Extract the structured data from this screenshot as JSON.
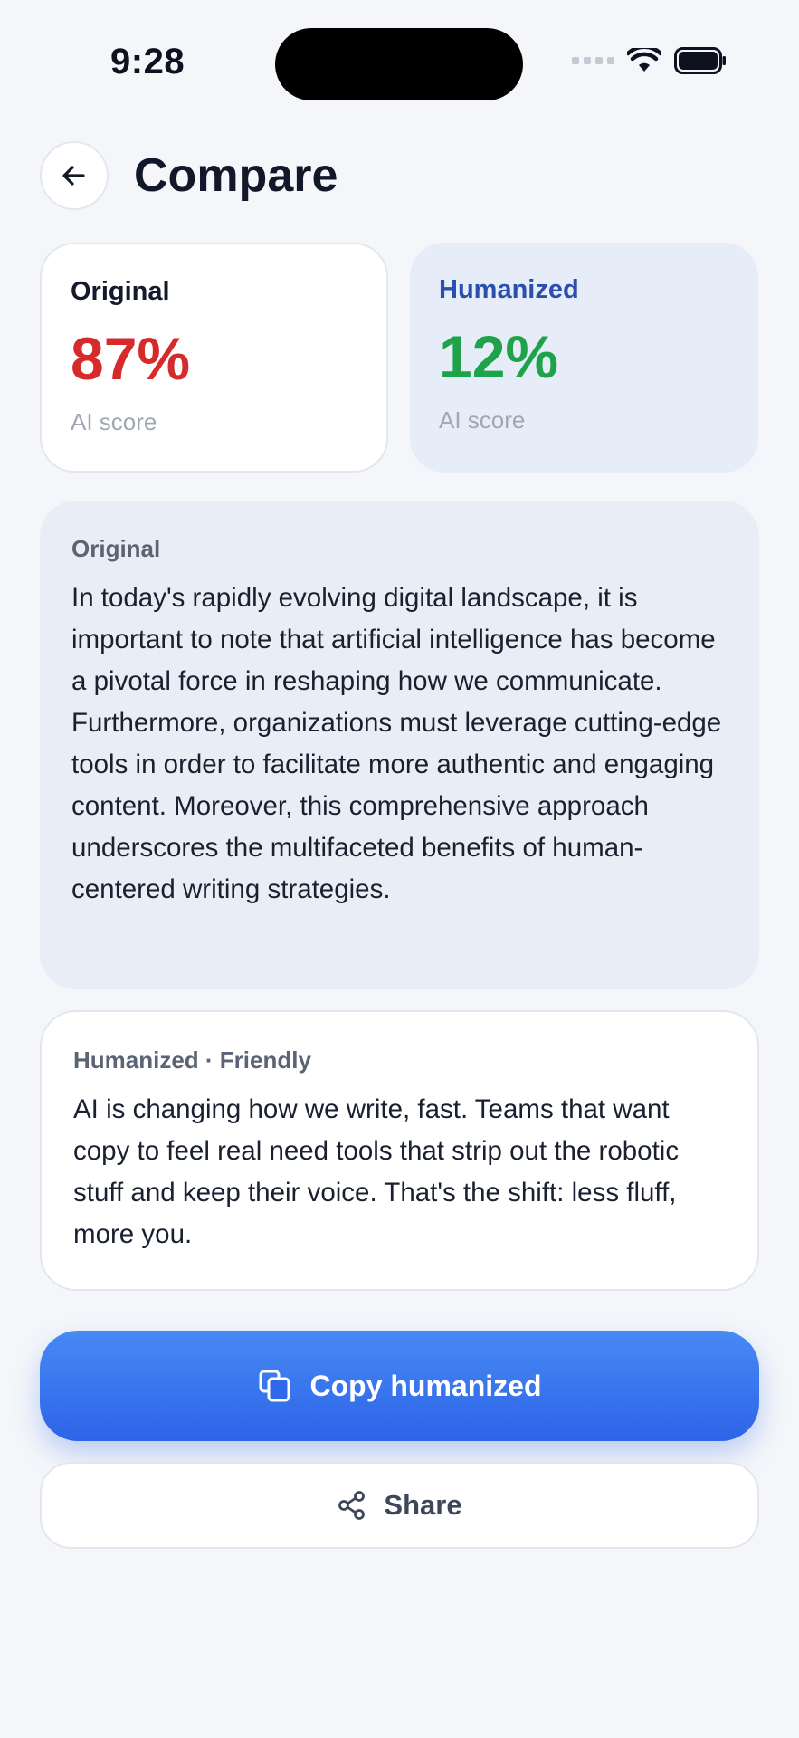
{
  "status_bar": {
    "time": "9:28"
  },
  "header": {
    "title": "Compare"
  },
  "scores": {
    "original": {
      "title": "Original",
      "value": "87%",
      "sub": "AI score"
    },
    "humanized": {
      "title": "Humanized",
      "value": "12%",
      "sub": "AI score"
    }
  },
  "original_text": {
    "label": "Original",
    "body": "In today's rapidly evolving digital landscape, it is important to note that artificial intelligence has become a pivotal force in reshaping how we communicate. Furthermore, organizations must leverage cutting-edge tools in order to facilitate more authentic and engaging content. Moreover, this comprehensive approach underscores the multifaceted benefits of human-centered writing strategies."
  },
  "humanized_text": {
    "label": "Humanized · Friendly",
    "body": "AI is changing how we write, fast. Teams that want copy to feel real need tools that strip out the robotic stuff and keep their voice. That's the shift: less fluff, more you."
  },
  "actions": {
    "copy_label": "Copy humanized",
    "share_label": "Share"
  },
  "colors": {
    "accent": "#2c64e8",
    "original_score": "#d62b2b",
    "humanized_score": "#1ea34a"
  },
  "icons": {
    "back": "arrow-left-icon",
    "copy": "copy-icon",
    "share": "share-icon"
  }
}
